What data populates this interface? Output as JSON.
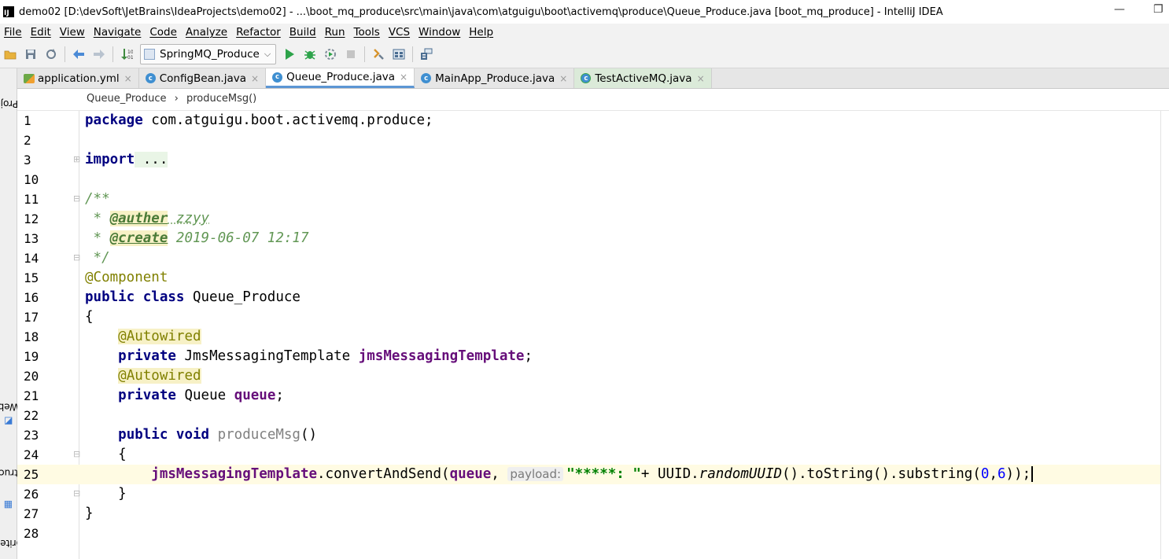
{
  "window": {
    "title": "demo02 [D:\\devSoft\\JetBrains\\IdeaProjects\\demo02] - ...\\boot_mq_produce\\src\\main\\java\\com\\atguigu\\boot\\activemq\\produce\\Queue_Produce.java [boot_mq_produce] - IntelliJ IDEA",
    "minimize_glyph": "—",
    "restore_glyph": "❐"
  },
  "menu": [
    "File",
    "Edit",
    "View",
    "Navigate",
    "Code",
    "Analyze",
    "Refactor",
    "Build",
    "Run",
    "Tools",
    "VCS",
    "Window",
    "Help"
  ],
  "toolbar": {
    "run_config_label": "SpringMQ_Produce"
  },
  "tool_windows": {
    "project": "1: Project",
    "web": "Web",
    "structure": "7: Structure",
    "favorites": "orites"
  },
  "tabs": [
    {
      "label": "application.yml",
      "type": "yml",
      "active": false
    },
    {
      "label": "ConfigBean.java",
      "type": "class",
      "active": false
    },
    {
      "label": "Queue_Produce.java",
      "type": "class",
      "active": true
    },
    {
      "label": "MainApp_Produce.java",
      "type": "class",
      "active": false
    },
    {
      "label": "TestActiveMQ.java",
      "type": "test",
      "active": false
    }
  ],
  "breadcrumb": {
    "class_name": "Queue_Produce",
    "separator": "›",
    "method_name": "produceMsg()"
  },
  "editor": {
    "line_numbers": [
      "1",
      "2",
      "3",
      "10",
      "11",
      "12",
      "13",
      "14",
      "15",
      "16",
      "17",
      "18",
      "19",
      "20",
      "21",
      "22",
      "23",
      "24",
      "25",
      "26",
      "27",
      "28"
    ],
    "current_line": "25",
    "code": {
      "l1_kw": "package",
      "l1_rest": " com.atguigu.boot.activemq.produce;",
      "l3_kw": "import",
      "l3_folded": " ...",
      "l11_open": "/**",
      "l12_star": " * ",
      "l12_tag": "@auther",
      "l12_val": " zzyy",
      "l13_star": " * ",
      "l13_tag": "@create",
      "l13_val": " 2019-06-07 12:17",
      "l14_close": " */",
      "l15_ann": "@Component",
      "l16_kw": "public class",
      "l16_rest": " Queue_Produce",
      "l17_brace": "{",
      "l18_ann": "@Autowired",
      "l19_kw": "private",
      "l19_type": " JmsMessagingTemplate ",
      "l19_field": "jmsMessagingTemplate",
      "l19_end": ";",
      "l20_ann": "@Autowired",
      "l21_kw": "private",
      "l21_type": " Queue ",
      "l21_field": "queue",
      "l21_end": ";",
      "l23_kw": "public void",
      "l23_name": " produceMsg",
      "l23_parens": "()",
      "l24_brace": "{",
      "l25_field": "jmsMessagingTemplate",
      "l25_call": ".convertAndSend(",
      "l25_arg": "queue",
      "l25_comma": ", ",
      "l25_hint": "payload:",
      "l25_str": "\"*****: \"",
      "l25_plus": "+ UUID.",
      "l25_static": "randomUUID",
      "l25_mid": "().toString().substring(",
      "l25_n0": "0",
      "l25_c": ",",
      "l25_n6": "6",
      "l25_end": "));",
      "l26_brace": "}",
      "l27_brace": "}"
    }
  }
}
